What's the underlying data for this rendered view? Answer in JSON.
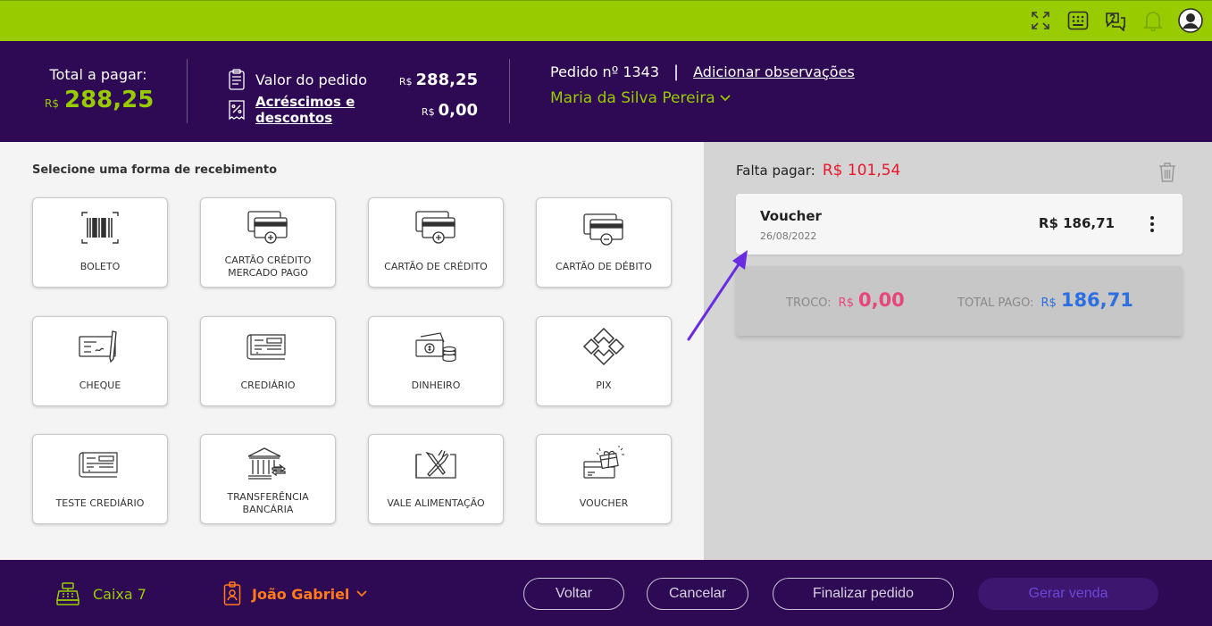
{
  "topbar": {
    "icons": [
      "fullscreen-icon",
      "keypad-icon",
      "help-chat-icon",
      "bell-icon",
      "user-avatar-icon"
    ]
  },
  "header": {
    "total_label": "Total a pagar:",
    "currency": "R$",
    "total_value": "288,25",
    "valor_pedido_label": "Valor do pedido",
    "valor_pedido_value": "288,25",
    "acrescimos_label": "Acréscimos e descontos",
    "acrescimos_value": "0,00",
    "pedido_label": "Pedido nº 1343",
    "separator": "|",
    "add_obs_label": "Adicionar observações",
    "client_name": "Maria da Silva Pereira"
  },
  "payment": {
    "title": "Selecione uma forma de recebimento",
    "methods": [
      {
        "label": "BOLETO",
        "icon": "barcode-icon"
      },
      {
        "label": "CARTÃO CRÉDITO MERCADO PAGO",
        "icon": "card-plus-icon"
      },
      {
        "label": "CARTÃO DE CRÉDITO",
        "icon": "card-plus-icon"
      },
      {
        "label": "CARTÃO DE DÉBITO",
        "icon": "card-minus-icon"
      },
      {
        "label": "CHEQUE",
        "icon": "cheque-icon"
      },
      {
        "label": "CREDIÁRIO",
        "icon": "crediario-icon"
      },
      {
        "label": "DINHEIRO",
        "icon": "cash-icon"
      },
      {
        "label": "PIX",
        "icon": "pix-icon"
      },
      {
        "label": "TESTE CREDIÁRIO",
        "icon": "crediario-icon"
      },
      {
        "label": "TRANSFERÊNCIA BANCÁRIA",
        "icon": "bank-transfer-icon"
      },
      {
        "label": "VALE ALIMENTAÇÃO",
        "icon": "fork-knife-icon"
      },
      {
        "label": "VOUCHER",
        "icon": "voucher-gift-icon"
      }
    ]
  },
  "summary": {
    "falta_label": "Falta pagar:",
    "falta_value": "R$ 101,54",
    "entry": {
      "name": "Voucher",
      "date": "26/08/2022",
      "amount": "R$ 186,71"
    },
    "troco_label": "TROCO:",
    "troco_currency": "R$",
    "troco_value": "0,00",
    "pago_label": "TOTAL PAGO:",
    "pago_currency": "R$",
    "pago_value": "186,71"
  },
  "footer": {
    "caixa_label": "Caixa 7",
    "operator_name": "João Gabriel",
    "voltar": "Voltar",
    "cancelar": "Cancelar",
    "finalizar": "Finalizar pedido",
    "gerar": "Gerar venda"
  },
  "colors": {
    "brand_green": "#99cc00",
    "brand_purple": "#2e0a55",
    "falta_red": "#e8172b",
    "troco_pink": "#e8457a",
    "pago_blue": "#2b6fe0",
    "operator_orange": "#ff7a1a",
    "arrow_violet": "#6a2ce0"
  }
}
